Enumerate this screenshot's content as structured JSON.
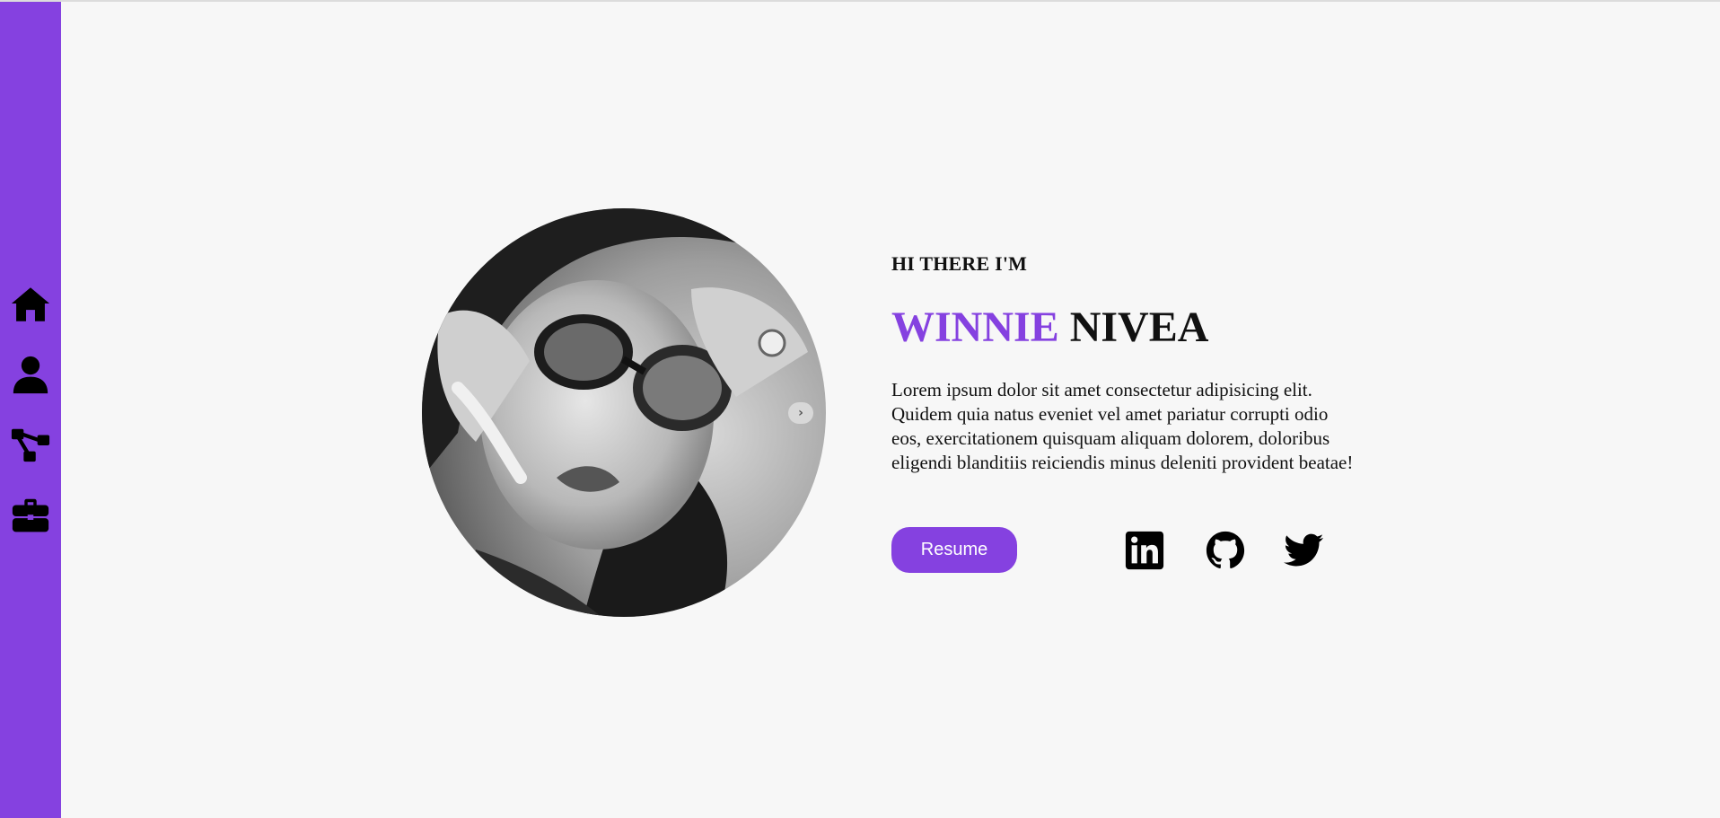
{
  "sidebar": {
    "items": [
      {
        "icon": "home-icon",
        "label": "Home"
      },
      {
        "icon": "user-icon",
        "label": "About"
      },
      {
        "icon": "sitemap-icon",
        "label": "Skills"
      },
      {
        "icon": "briefcase-icon",
        "label": "Portfolio"
      }
    ]
  },
  "hero": {
    "greeting": "HI THERE I'M",
    "first_name": "WINNIE",
    "last_name": "NIVEA",
    "bio": "Lorem ipsum dolor sit amet consectetur adipisicing elit. Quidem quia natus eveniet vel amet pariatur corrupti odio eos, exercitationem quisquam aliquam dolorem, doloribus eligendi blanditiis reiciendis minus deleniti provident beatae!",
    "resume_label": "Resume",
    "next_glyph": "›"
  },
  "social": [
    {
      "icon": "linkedin-icon"
    },
    {
      "icon": "github-icon"
    },
    {
      "icon": "twitter-icon"
    }
  ],
  "colors": {
    "accent": "#8541e0",
    "background": "#f7f7f7",
    "text": "#111111"
  }
}
